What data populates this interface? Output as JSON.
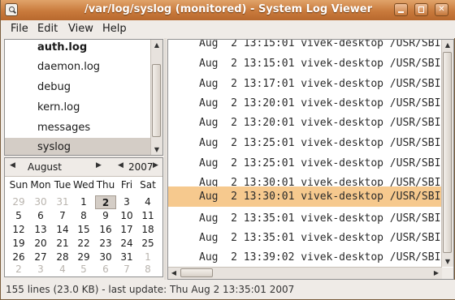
{
  "window": {
    "title": "/var/log/syslog (monitored) - System Log Viewer"
  },
  "menu": {
    "items": [
      {
        "label": "File"
      },
      {
        "label": "Edit"
      },
      {
        "label": "View"
      },
      {
        "label": "Help"
      }
    ]
  },
  "log_files": [
    {
      "label": "auth.log"
    },
    {
      "label": "daemon.log"
    },
    {
      "label": "debug"
    },
    {
      "label": "kern.log"
    },
    {
      "label": "messages"
    },
    {
      "label": "syslog"
    }
  ],
  "calendar": {
    "month": "August",
    "year": "2007",
    "weekdays": [
      "Sun",
      "Mon",
      "Tue",
      "Wed",
      "Thu",
      "Fri",
      "Sat"
    ],
    "weeks": [
      [
        "29",
        "30",
        "31",
        "1",
        "2",
        "3",
        "4"
      ],
      [
        "5",
        "6",
        "7",
        "8",
        "9",
        "10",
        "11"
      ],
      [
        "12",
        "13",
        "14",
        "15",
        "16",
        "17",
        "18"
      ],
      [
        "19",
        "20",
        "21",
        "22",
        "23",
        "24",
        "25"
      ],
      [
        "26",
        "27",
        "28",
        "29",
        "30",
        "31",
        "1"
      ],
      [
        "2",
        "3",
        "4",
        "5",
        "6",
        "7",
        "8"
      ]
    ],
    "selected_day": "2"
  },
  "log_lines": [
    "Aug  2 13:15:01 vivek-desktop /USR/SBI",
    "Aug  2 13:15:01 vivek-desktop /USR/SBI",
    "Aug  2 13:17:01 vivek-desktop /USR/SBI",
    "Aug  2 13:20:01 vivek-desktop /USR/SBI",
    "Aug  2 13:20:01 vivek-desktop /USR/SBI",
    "Aug  2 13:25:01 vivek-desktop /USR/SBI",
    "Aug  2 13:25:01 vivek-desktop /USR/SBI",
    "Aug  2 13:30:01 vivek-desktop /USR/SBI",
    "Aug  2 13:30:01 vivek-desktop /USR/SBI",
    "Aug  2 13:35:01 vivek-desktop /USR/SBI",
    "Aug  2 13:35:01 vivek-desktop /USR/SBI",
    "Aug  2 13:39:02 vivek-desktop /USR/SBI"
  ],
  "status": {
    "text": "155 lines (23.0 KB) - last update: Thu Aug  2 13:35:01 2007"
  },
  "colors": {
    "titlebar": "#c97a3c",
    "highlight_row": "#f6c98e",
    "selected_list_item": "#d4cdc6"
  }
}
